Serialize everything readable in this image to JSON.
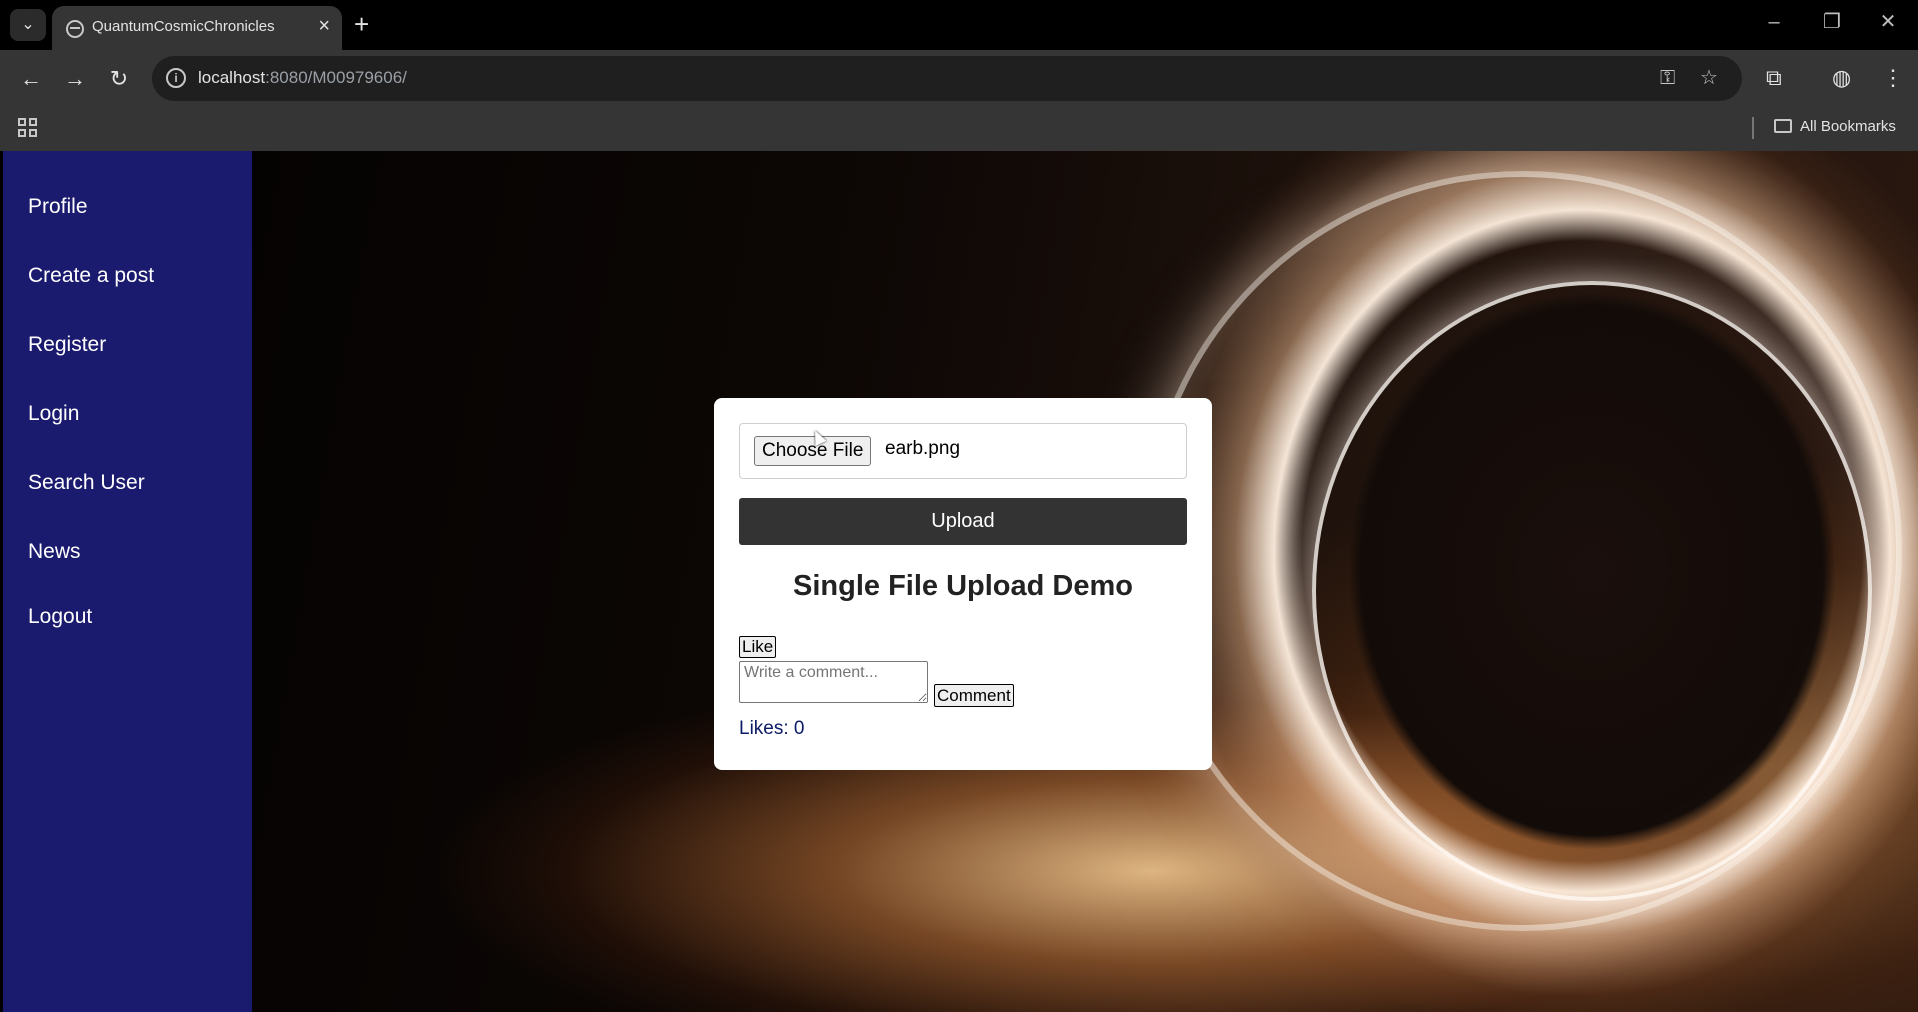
{
  "browser": {
    "tab_title": "QuantumCosmicChronicles",
    "url_host": "localhost",
    "url_rest": ":8080/M00979606/",
    "bookmarks_label": "All Bookmarks"
  },
  "sidebar": {
    "items": [
      {
        "label": "Profile"
      },
      {
        "label": "Create a post"
      },
      {
        "label": "Register"
      },
      {
        "label": "Login"
      },
      {
        "label": "Search User"
      },
      {
        "label": "News"
      },
      {
        "label": "Logout"
      }
    ]
  },
  "upload": {
    "choose_label": "Choose File",
    "file_name": "earb.png",
    "upload_label": "Upload",
    "title": "Single File Upload Demo"
  },
  "post": {
    "like_label": "Like",
    "comment_placeholder": "Write a comment...",
    "comment_label": "Comment",
    "likes_text": "Likes: 0"
  },
  "colors": {
    "sidebar_bg": "#1a1a6e",
    "upload_btn_bg": "#333333",
    "likes_text": "#0a1a66"
  }
}
